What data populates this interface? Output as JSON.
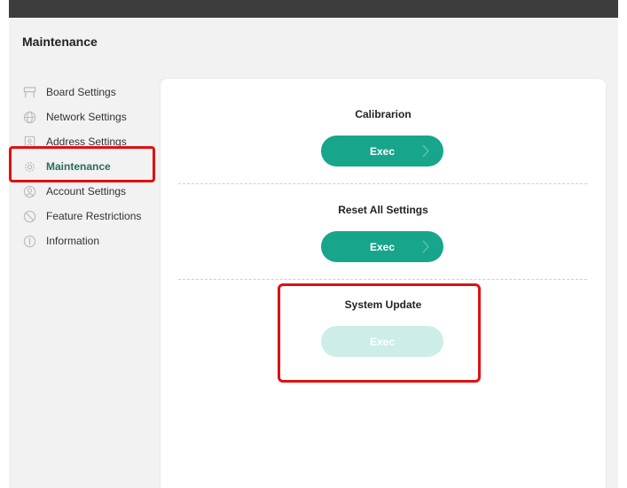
{
  "page": {
    "title": "Maintenance"
  },
  "sidebar": {
    "items": [
      {
        "label": "Board Settings",
        "icon": "board-icon",
        "active": false
      },
      {
        "label": "Network Settings",
        "icon": "globe-icon",
        "active": false
      },
      {
        "label": "Address Settings",
        "icon": "address-book-icon",
        "active": false
      },
      {
        "label": "Maintenance",
        "icon": "gear-icon",
        "active": true
      },
      {
        "label": "Account Settings",
        "icon": "user-icon",
        "active": false
      },
      {
        "label": "Feature Restrictions",
        "icon": "prohibited-icon",
        "active": false
      },
      {
        "label": "Information",
        "icon": "info-icon",
        "active": false
      }
    ]
  },
  "main": {
    "sections": [
      {
        "title": "Calibrarion",
        "button_label": "Exec",
        "enabled": true
      },
      {
        "title": "Reset All Settings",
        "button_label": "Exec",
        "enabled": true
      },
      {
        "title": "System Update",
        "button_label": "Exec",
        "enabled": false
      }
    ]
  },
  "colors": {
    "accent": "#17a58c",
    "accent_disabled": "#cdeee8",
    "active_text": "#2a6b5e",
    "highlight": "#e01010"
  }
}
